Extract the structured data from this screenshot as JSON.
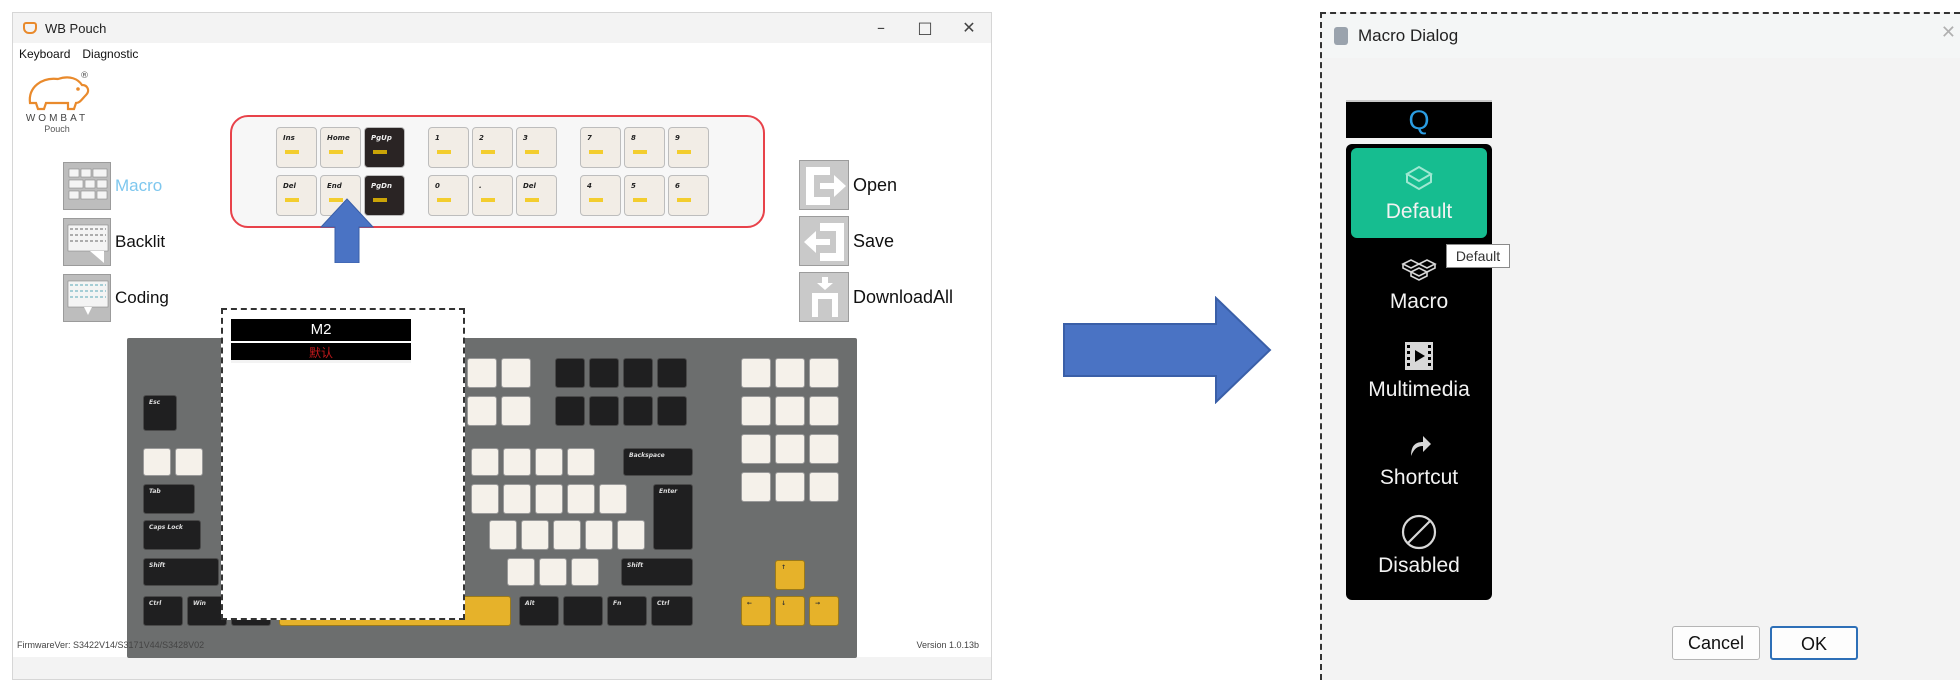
{
  "app": {
    "title": "WB Pouch",
    "menu": [
      "Keyboard",
      "Diagnostic"
    ],
    "logo": {
      "reg": "®",
      "brand": "WOMBAT",
      "sub": "Pouch"
    },
    "side_buttons": [
      {
        "label": "Macro",
        "icon": "macro-grid-icon",
        "active": true
      },
      {
        "label": "Backlit",
        "icon": "backlit-icon",
        "active": false
      },
      {
        "label": "Coding",
        "icon": "coding-icon",
        "active": false
      }
    ],
    "right_buttons": [
      {
        "label": "Open",
        "icon": "open-arrow-icon"
      },
      {
        "label": "Save",
        "icon": "save-arrow-icon"
      },
      {
        "label": "DownloadAll",
        "icon": "download-icon"
      }
    ],
    "macro_keys_row1": [
      "Ins",
      "Home",
      "PgUp",
      "1",
      "2",
      "3",
      "7",
      "8",
      "9"
    ],
    "macro_keys_row2": [
      "Del",
      "End",
      "PgDn",
      "0",
      ".",
      "Del",
      "4",
      "5",
      "6"
    ],
    "popup": {
      "key_name": "M2",
      "sub": "默认"
    },
    "footer": {
      "firmware": "FirmwareVer:   S3422V14/S3171V44/S3428V02",
      "version": "Version 1.0.13b"
    },
    "colors": {
      "accent": "#7ec7ee",
      "panel_border": "#e8424a",
      "arrow": "#4a73c4"
    }
  },
  "dialog": {
    "title": "Macro Dialog",
    "key": "Q",
    "options": [
      {
        "label": "Default",
        "icon": "keycap-icon",
        "selected": true
      },
      {
        "label": "Macro",
        "icon": "keycaps-icon",
        "selected": false
      },
      {
        "label": "Multimedia",
        "icon": "film-icon",
        "selected": false
      },
      {
        "label": "Shortcut",
        "icon": "shortcut-arrow-icon",
        "selected": false
      },
      {
        "label": "Disabled",
        "icon": "disabled-icon",
        "selected": false
      }
    ],
    "tooltip": "Default",
    "cancel_label": "Cancel",
    "ok_label": "OK",
    "colors": {
      "selected": "#16bd90",
      "key_text": "#2b9de2"
    }
  }
}
